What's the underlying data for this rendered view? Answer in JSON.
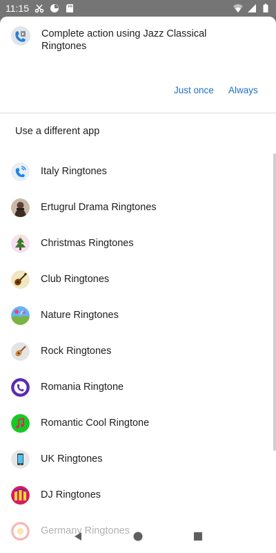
{
  "status_bar": {
    "time": "11:15",
    "left_icons": [
      "scissors-icon",
      "timer-icon",
      "sd-card-icon"
    ],
    "right_icons": [
      "wifi-icon",
      "signal-icon",
      "battery-icon"
    ]
  },
  "dialog": {
    "title": "Complete action using Jazz Classical Ringtones",
    "app_icon": "jazz-ringtones-icon",
    "buttons": {
      "just_once": "Just once",
      "always": "Always"
    },
    "section_title": "Use a different app",
    "apps": [
      {
        "label": "Italy Ringtones",
        "icon": "phone-waves-icon",
        "color": "#1e88e5"
      },
      {
        "label": "Ertugrul Drama Ringtones",
        "icon": "portrait-icon",
        "color": "#5d4037"
      },
      {
        "label": "Christmas Ringtones",
        "icon": "christmas-tree-icon",
        "color": "#2e7d32"
      },
      {
        "label": "Club Ringtones",
        "icon": "guitar-icon",
        "color": "#7b3f00"
      },
      {
        "label": "Nature Ringtones",
        "icon": "landscape-icon",
        "color": "#7cb342"
      },
      {
        "label": "Rock Ringtones",
        "icon": "guitar-icon",
        "color": "#a0522d"
      },
      {
        "label": "Romania Ringtone",
        "icon": "phone-icon",
        "color": "#5b2bb0"
      },
      {
        "label": "Romantic Cool Ringtone",
        "icon": "music-note-icon",
        "color": "#17c923"
      },
      {
        "label": "UK Ringtones",
        "icon": "phone-device-icon",
        "color": "#607d8b"
      },
      {
        "label": "DJ Ringtones",
        "icon": "speaker-icon",
        "color": "#d81b60"
      },
      {
        "label": "Germany Ringtones",
        "icon": "germany-icon",
        "color": "#e53935"
      }
    ]
  },
  "nav_bar": {
    "icons": [
      "back-icon",
      "home-icon",
      "recents-icon"
    ]
  }
}
